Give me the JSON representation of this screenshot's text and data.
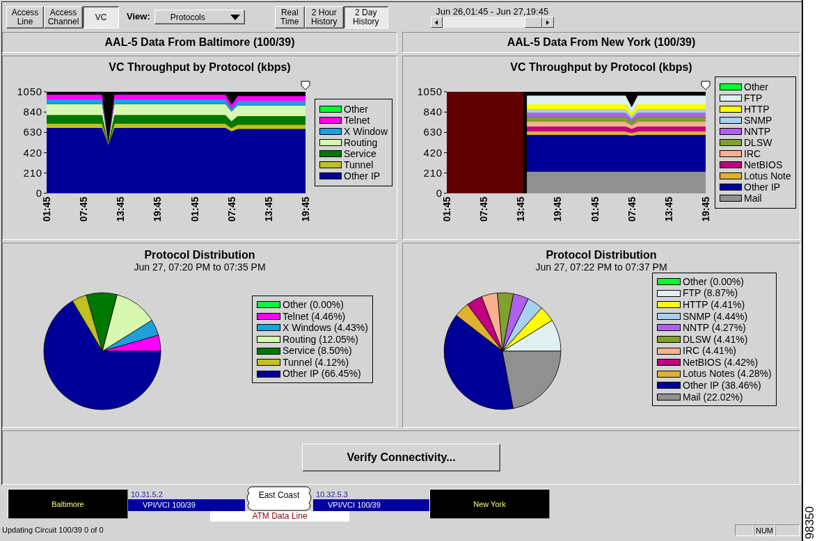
{
  "toolbar": {
    "tabs": [
      {
        "label": "Access Line",
        "selected": false
      },
      {
        "label": "Access Channel",
        "selected": false
      },
      {
        "label": "VC",
        "selected": true
      }
    ],
    "view": {
      "label": "View:",
      "value": "Protocols"
    },
    "time_tabs": [
      {
        "label": "Real Time",
        "selected": false
      },
      {
        "label": "2 Hour History",
        "selected": false
      },
      {
        "label": "2 Day History",
        "selected": true
      }
    ],
    "time_range": "Jun 26,01:45 - Jun 27,19:45"
  },
  "panels": [
    {
      "title": "AAL-5 Data From Baltimore (100/39)",
      "throughput": {
        "chart_data": {
          "type": "area",
          "title": "VC Throughput by Protocol (kbps)",
          "stacked": true,
          "categories": [
            "01:45",
            null,
            null,
            null,
            null,
            null,
            "07:45",
            null,
            null,
            null,
            null,
            null,
            "13:45",
            null,
            null,
            null,
            null,
            null,
            "19:45",
            null,
            null,
            null,
            null,
            null,
            "01:45",
            null,
            null,
            null,
            null,
            null,
            "07:45",
            null,
            null,
            null,
            null,
            null,
            "13:45",
            null,
            null,
            null,
            null,
            null,
            "19:45"
          ],
          "ylim": [
            0,
            1050
          ],
          "yticks": [
            0,
            210,
            420,
            630,
            840,
            1050
          ],
          "series": [
            {
              "name": "Other",
              "color": "#00ff33",
              "values": [
                null,
                null,
                null,
                null,
                null,
                null,
                null,
                null,
                null,
                null,
                null,
                null,
                null,
                null,
                null,
                null,
                null,
                null,
                null,
                null,
                null,
                null,
                null,
                null,
                null,
                null,
                null,
                null,
                null,
                null,
                null,
                null,
                null,
                null,
                null,
                null,
                null,
                null,
                null,
                null,
                null,
                null,
                null
              ]
            },
            {
              "name": "Telnet",
              "color": "#ff00ff",
              "values": [
                49,
                49,
                49,
                49,
                49,
                49,
                49,
                49,
                49,
                49,
                5,
                49,
                49,
                49,
                49,
                49,
                49,
                49,
                49,
                49,
                49,
                49,
                49,
                49,
                49,
                49,
                49,
                49,
                49,
                49,
                40,
                49,
                49,
                49,
                49,
                49,
                49,
                49,
                49,
                49,
                49,
                49,
                49
              ]
            },
            {
              "name": "X Window",
              "color": "#1ea0dc",
              "values": [
                48,
                48,
                48,
                48,
                48,
                48,
                48,
                48,
                48,
                48,
                5,
                48,
                48,
                48,
                48,
                48,
                48,
                48,
                48,
                48,
                48,
                48,
                48,
                48,
                48,
                48,
                48,
                48,
                48,
                48,
                30,
                48,
                48,
                48,
                48,
                48,
                48,
                48,
                48,
                48,
                48,
                48,
                48
              ]
            },
            {
              "name": "Routing",
              "color": "#d8f8b0",
              "values": [
                115,
                115,
                115,
                115,
                115,
                115,
                115,
                115,
                115,
                115,
                5,
                115,
                115,
                115,
                115,
                115,
                115,
                115,
                115,
                115,
                115,
                115,
                115,
                115,
                115,
                115,
                115,
                115,
                115,
                115,
                100,
                110,
                110,
                110,
                110,
                110,
                110,
                110,
                110,
                110,
                110,
                110,
                110
              ]
            },
            {
              "name": "Service",
              "color": "#007800",
              "values": [
                88,
                88,
                88,
                88,
                88,
                88,
                88,
                88,
                88,
                88,
                5,
                88,
                88,
                88,
                88,
                88,
                88,
                88,
                88,
                88,
                88,
                88,
                88,
                88,
                88,
                88,
                88,
                88,
                88,
                88,
                70,
                88,
                88,
                88,
                88,
                88,
                88,
                88,
                88,
                88,
                88,
                88,
                88
              ]
            },
            {
              "name": "Tunnel",
              "color": "#c0c020",
              "values": [
                45,
                45,
                45,
                45,
                45,
                45,
                45,
                45,
                45,
                45,
                5,
                45,
                45,
                45,
                45,
                45,
                45,
                45,
                45,
                45,
                45,
                45,
                45,
                45,
                45,
                45,
                45,
                45,
                45,
                45,
                35,
                45,
                45,
                45,
                45,
                45,
                45,
                45,
                45,
                45,
                45,
                45,
                45
              ]
            },
            {
              "name": "Other IP",
              "color": "#000099",
              "values": [
                675,
                675,
                675,
                675,
                675,
                675,
                675,
                675,
                675,
                675,
                500,
                675,
                675,
                675,
                675,
                675,
                675,
                675,
                675,
                675,
                675,
                675,
                675,
                675,
                675,
                675,
                675,
                675,
                675,
                675,
                640,
                665,
                665,
                665,
                665,
                665,
                665,
                665,
                665,
                665,
                665,
                665,
                665
              ]
            }
          ]
        }
      },
      "distribution": {
        "subtitle": "Jun 27, 07:20 PM to 07:35 PM",
        "legend": [
          {
            "color": "#00ff33"
          },
          {
            "color": "#ff00ff"
          },
          {
            "color": "#1ea0dc"
          },
          {
            "color": "#d8f8b0"
          },
          {
            "color": "#007800"
          },
          {
            "color": "#c0c020"
          },
          {
            "color": "#000099"
          }
        ],
        "chart_data": {
          "type": "pie",
          "title": "Protocol Distribution",
          "categories": [
            "Other (0.00%)",
            "Telnet (4.46%)",
            "X Windows (4.43%)",
            "Routing (12.05%)",
            "Service (8.50%)",
            "Tunnel (4.12%)",
            "Other IP (66.45%)"
          ],
          "values": [
            0.0,
            4.46,
            4.43,
            12.05,
            8.5,
            4.12,
            66.45
          ]
        }
      }
    },
    {
      "title": "AAL-5 Data From New York (100/39)",
      "throughput": {
        "chart_data": {
          "type": "area",
          "title": "VC Throughput by Protocol (kbps)",
          "stacked": true,
          "categories": [
            "01:45",
            null,
            null,
            null,
            null,
            null,
            "07:45",
            null,
            null,
            null,
            null,
            null,
            "13:45",
            null,
            null,
            null,
            null,
            null,
            "19:45",
            null,
            null,
            null,
            null,
            null,
            "01:45",
            null,
            null,
            null,
            null,
            null,
            "07:45",
            null,
            null,
            null,
            null,
            null,
            "13:45",
            null,
            null,
            null,
            null,
            null,
            "19:45"
          ],
          "ylim": [
            0,
            1050
          ],
          "yticks": [
            0,
            210,
            420,
            630,
            840,
            1050
          ],
          "series": [
            {
              "name": "Other",
              "color": "#00ff33",
              "values": [
                null,
                null,
                null,
                null,
                null,
                null,
                null,
                null,
                null,
                null,
                null,
                null,
                null,
                null,
                null,
                null,
                null,
                null,
                null,
                null,
                null,
                null,
                null,
                null,
                null,
                null,
                null,
                null,
                null,
                null,
                null,
                null,
                null,
                null,
                null,
                null,
                null,
                null,
                null,
                null,
                null,
                null,
                null
              ]
            },
            {
              "name": "FTP",
              "color": "#e0f0f0",
              "values": [
                null,
                null,
                null,
                null,
                null,
                null,
                null,
                null,
                null,
                null,
                null,
                null,
                null,
                90,
                90,
                90,
                90,
                90,
                90,
                90,
                90,
                90,
                90,
                90,
                90,
                90,
                90,
                90,
                90,
                90,
                60,
                90,
                90,
                90,
                90,
                90,
                90,
                90,
                90,
                90,
                90,
                90,
                90
              ]
            },
            {
              "name": "HTTP",
              "color": "#ffff00",
              "values": [
                null,
                null,
                null,
                null,
                null,
                null,
                null,
                null,
                null,
                null,
                null,
                null,
                null,
                55,
                55,
                55,
                55,
                55,
                55,
                55,
                55,
                55,
                55,
                55,
                55,
                55,
                55,
                55,
                55,
                55,
                35,
                55,
                55,
                55,
                55,
                55,
                55,
                55,
                55,
                55,
                55,
                55,
                55
              ]
            },
            {
              "name": "SNMP",
              "color": "#a8d0f0",
              "values": [
                null,
                null,
                null,
                null,
                null,
                null,
                null,
                null,
                null,
                null,
                null,
                null,
                null,
                35,
                35,
                35,
                35,
                35,
                35,
                35,
                35,
                35,
                35,
                35,
                35,
                35,
                35,
                35,
                35,
                35,
                25,
                35,
                35,
                35,
                35,
                35,
                35,
                35,
                35,
                35,
                35,
                35,
                35
              ]
            },
            {
              "name": "NNTP",
              "color": "#b060f0",
              "values": [
                null,
                null,
                null,
                null,
                null,
                null,
                null,
                null,
                null,
                null,
                null,
                null,
                null,
                40,
                40,
                40,
                40,
                40,
                40,
                40,
                40,
                40,
                40,
                40,
                40,
                40,
                40,
                40,
                40,
                40,
                30,
                40,
                40,
                40,
                40,
                40,
                40,
                40,
                40,
                40,
                40,
                40,
                40
              ]
            },
            {
              "name": "DLSW",
              "color": "#80a030",
              "values": [
                null,
                null,
                null,
                null,
                null,
                null,
                null,
                null,
                null,
                null,
                null,
                null,
                null,
                50,
                50,
                50,
                50,
                50,
                50,
                50,
                50,
                50,
                50,
                50,
                50,
                50,
                50,
                50,
                50,
                50,
                35,
                50,
                50,
                50,
                50,
                50,
                50,
                50,
                50,
                50,
                50,
                50,
                50
              ]
            },
            {
              "name": "IRC",
              "color": "#f8b090",
              "values": [
                null,
                null,
                null,
                null,
                null,
                null,
                null,
                null,
                null,
                null,
                null,
                null,
                null,
                50,
                50,
                50,
                50,
                50,
                50,
                50,
                50,
                50,
                50,
                50,
                50,
                50,
                50,
                50,
                50,
                50,
                40,
                50,
                50,
                50,
                50,
                50,
                50,
                50,
                50,
                50,
                50,
                50,
                50
              ]
            },
            {
              "name": "NetBIOS",
              "color": "#c00080",
              "values": [
                null,
                null,
                null,
                null,
                null,
                null,
                null,
                null,
                null,
                null,
                null,
                null,
                null,
                50,
                50,
                50,
                50,
                50,
                50,
                50,
                50,
                50,
                50,
                50,
                50,
                50,
                50,
                50,
                50,
                50,
                40,
                50,
                50,
                50,
                50,
                50,
                50,
                50,
                50,
                50,
                50,
                50,
                50
              ]
            },
            {
              "name": "Lotus Note",
              "color": "#e0b030",
              "values": [
                null,
                null,
                null,
                null,
                null,
                null,
                null,
                null,
                null,
                null,
                null,
                null,
                null,
                35,
                35,
                35,
                35,
                35,
                35,
                35,
                35,
                35,
                35,
                35,
                35,
                35,
                35,
                35,
                35,
                35,
                30,
                35,
                35,
                35,
                35,
                35,
                35,
                35,
                35,
                35,
                35,
                35,
                35
              ]
            },
            {
              "name": "Other IP",
              "color": "#000099",
              "values": [
                null,
                null,
                null,
                null,
                null,
                null,
                null,
                null,
                null,
                null,
                null,
                null,
                null,
                380,
                380,
                380,
                380,
                380,
                380,
                380,
                380,
                380,
                380,
                380,
                380,
                380,
                380,
                380,
                380,
                380,
                370,
                380,
                380,
                380,
                380,
                380,
                380,
                380,
                380,
                380,
                380,
                380,
                380
              ]
            },
            {
              "name": "Mail",
              "color": "#909090",
              "values": [
                null,
                null,
                null,
                null,
                null,
                null,
                null,
                null,
                null,
                null,
                null,
                null,
                null,
                225,
                225,
                225,
                225,
                225,
                225,
                225,
                225,
                225,
                225,
                225,
                225,
                225,
                225,
                225,
                225,
                225,
                225,
                225,
                225,
                225,
                225,
                225,
                225,
                225,
                225,
                225,
                225,
                225,
                225
              ]
            }
          ]
        }
      },
      "distribution": {
        "subtitle": "Jun 27, 07:22 PM to 07:37 PM",
        "legend": [
          {
            "color": "#00ff33"
          },
          {
            "color": "#e0f0f0"
          },
          {
            "color": "#ffff00"
          },
          {
            "color": "#a8d0f0"
          },
          {
            "color": "#b060f0"
          },
          {
            "color": "#80a030"
          },
          {
            "color": "#f8b090"
          },
          {
            "color": "#c00080"
          },
          {
            "color": "#e0b030"
          },
          {
            "color": "#000099"
          },
          {
            "color": "#909090"
          }
        ],
        "chart_data": {
          "type": "pie",
          "title": "Protocol Distribution",
          "categories": [
            "Other (0.00%)",
            "FTP (8.87%)",
            "HTTP (4.41%)",
            "SNMP (4.44%)",
            "NNTP (4.27%)",
            "DLSW (4.41%)",
            "IRC (4.41%)",
            "NetBIOS (4.42%)",
            "Lotus Notes (4.28%)",
            "Other IP (38.46%)",
            "Mail (22.02%)"
          ],
          "values": [
            0.0,
            8.87,
            4.41,
            4.44,
            4.27,
            4.41,
            4.41,
            4.42,
            4.28,
            38.46,
            22.02
          ]
        }
      }
    }
  ],
  "verify_button": {
    "label": "Verify Connectivity..."
  },
  "circuit": {
    "sites": [
      {
        "name": "Baltimore"
      },
      {
        "name": "New York"
      }
    ],
    "links": [
      {
        "address": "10.31.5.2",
        "label": "VPI/VCI 100/39"
      },
      {
        "address": "10.32.5.3",
        "label": "VPI/VCI 100/39"
      }
    ],
    "cloud": {
      "name": "East Coast",
      "caption": "ATM Data Line"
    }
  },
  "status_bar": {
    "message": "Updating Circuit 100/39 0 of 0",
    "indicators": [
      "NUM"
    ]
  },
  "figure_number": "98350"
}
